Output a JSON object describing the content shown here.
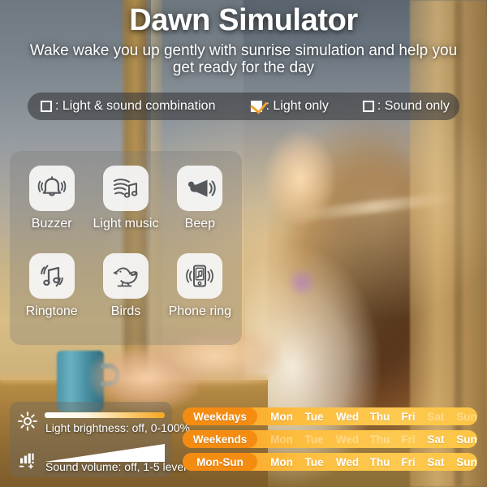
{
  "hero": {
    "title": "Dawn Simulator",
    "subtitle": "Wake wake you up gently with sunrise simulation and help you get ready for the day"
  },
  "modes": {
    "options": [
      {
        "label": ": Light & sound combination",
        "checked": false,
        "name": "light-sound-combination"
      },
      {
        "label": ": Light only",
        "checked": true,
        "name": "light-only"
      },
      {
        "label": ": Sound only",
        "checked": false,
        "name": "sound-only"
      }
    ],
    "accent": "#f0a12e"
  },
  "sounds": {
    "items": [
      {
        "label": "Buzzer",
        "icon": "bell-icon"
      },
      {
        "label": "Light music",
        "icon": "music-waves-icon"
      },
      {
        "label": "Beep",
        "icon": "horn-icon"
      },
      {
        "label": "Ringtone",
        "icon": "music-note-ring-icon"
      },
      {
        "label": "Birds",
        "icon": "bird-icon"
      },
      {
        "label": "Phone ring",
        "icon": "phone-ring-icon"
      }
    ]
  },
  "sliders": {
    "brightness": {
      "label": "Light brightness: off, 0-100%",
      "icon": "sun-icon"
    },
    "volume": {
      "label": "Sound volume: off, 1-5 level",
      "icon": "volume-bars-icon"
    }
  },
  "schedule": {
    "days": [
      "Mon",
      "Tue",
      "Wed",
      "Thu",
      "Fri",
      "Sat",
      "Sun"
    ],
    "rows": [
      {
        "label": "Weekdays",
        "active": [
          true,
          true,
          true,
          true,
          true,
          false,
          false
        ]
      },
      {
        "label": "Weekends",
        "active": [
          false,
          false,
          false,
          false,
          false,
          true,
          true
        ]
      },
      {
        "label": "Mon-Sun",
        "active": [
          true,
          true,
          true,
          true,
          true,
          true,
          true
        ]
      }
    ],
    "colors": {
      "pill": "#f58c12",
      "track_start": "#f79a1e",
      "track_end": "#fcc444"
    }
  }
}
